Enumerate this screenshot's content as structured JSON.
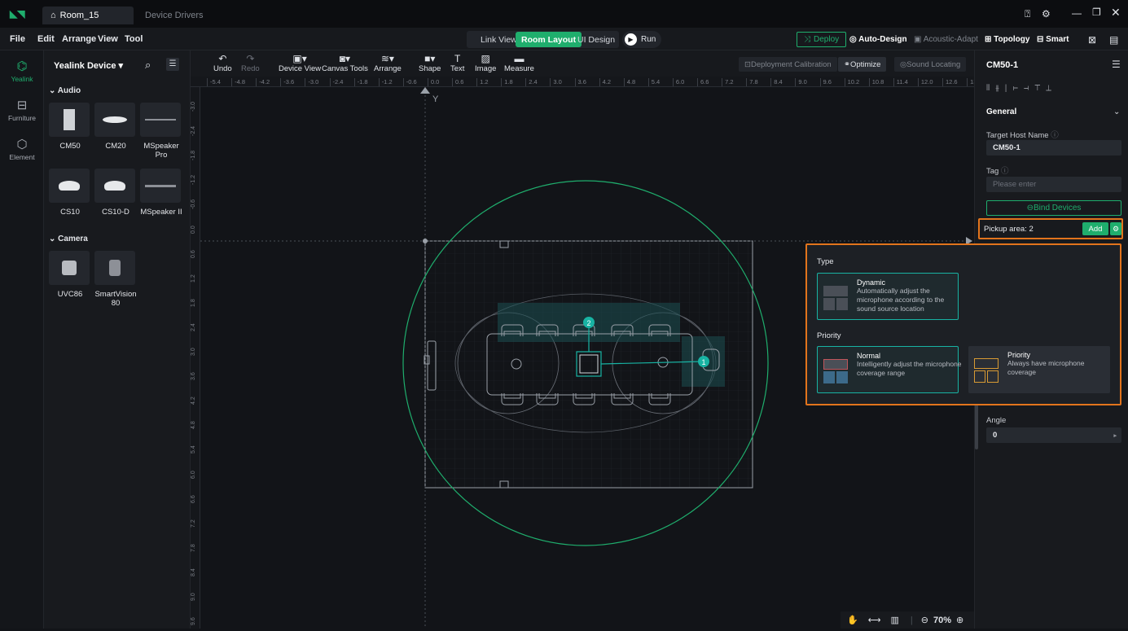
{
  "titlebar": {
    "tabs": [
      {
        "label": "Room_15"
      },
      {
        "label": "Device Drivers"
      }
    ],
    "window_controls": [
      "help-icon",
      "settings-icon",
      "minimize-icon",
      "restore-icon",
      "close-icon"
    ]
  },
  "menubar": {
    "menus": [
      "File",
      "Edit",
      "Arrange",
      "View",
      "Tool"
    ],
    "modes": [
      "Link View",
      "Room Layout",
      "UI Design"
    ],
    "active_mode": "Room Layout",
    "run_label": "Run",
    "right": {
      "deploy": "Deploy",
      "auto_design": "Auto-Design",
      "acoustic_adapt": "Acoustic-Adapt",
      "topology": "Topology",
      "smart": "Smart"
    }
  },
  "leftbar": {
    "items": [
      {
        "label": "Yealink",
        "icon": "cube-icon"
      },
      {
        "label": "Furniture",
        "icon": "chair-icon"
      },
      {
        "label": "Element",
        "icon": "element-icon"
      }
    ]
  },
  "device_panel": {
    "title": "Yealink Device",
    "sections": [
      {
        "name": "Audio",
        "devices": [
          {
            "label": "CM50"
          },
          {
            "label": "CM20"
          },
          {
            "label": "MSpeaker Pro"
          },
          {
            "label": "CS10"
          },
          {
            "label": "CS10-D"
          },
          {
            "label": "MSpeaker II"
          }
        ]
      },
      {
        "name": "Camera",
        "devices": [
          {
            "label": "UVC86"
          },
          {
            "label": "SmartVision 80"
          }
        ]
      }
    ]
  },
  "toolbar": {
    "tools": [
      {
        "label": "Undo"
      },
      {
        "label": "Redo"
      },
      {
        "label": "Device View"
      },
      {
        "label": "Canvas Tools"
      },
      {
        "label": "Arrange"
      },
      {
        "label": "Shape"
      },
      {
        "label": "Text"
      },
      {
        "label": "Image"
      },
      {
        "label": "Measure"
      }
    ],
    "right": {
      "calibration": "Deployment Calibration",
      "optimize": "Optimize",
      "locating": "Sound Locating"
    }
  },
  "rulers": {
    "top": [
      "-5.4",
      "-4.8",
      "-4.2",
      "-3.6",
      "-3.0",
      "-2.4",
      "-1.8",
      "-1.2",
      "-0.6",
      "0.0",
      "0.6",
      "1.2",
      "1.8",
      "2.4",
      "3.0",
      "3.6",
      "4.2",
      "4.8",
      "5.4",
      "6.0",
      "6.6",
      "7.2",
      "7.8",
      "8.4",
      "9.0",
      "9.6",
      "10.2",
      "10.8",
      "11.4",
      "12.0",
      "12.6",
      "13"
    ],
    "left": [
      "-3.0",
      "-2.4",
      "-1.8",
      "-1.2",
      "-0.6",
      "0.0",
      "0.6",
      "1.2",
      "1.8",
      "2.4",
      "3.0",
      "3.6",
      "4.2",
      "4.8",
      "5.4",
      "6.0",
      "6.6",
      "7.2",
      "7.8",
      "8.4",
      "9.0",
      "9.6"
    ]
  },
  "canvas": {
    "axis_y_label": "Y",
    "mic_markers": [
      "1",
      "2"
    ]
  },
  "right_panel": {
    "title": "CM50-1",
    "section": "General",
    "target_host_label": "Target Host Name",
    "target_host_value": "CM50-1",
    "tag_label": "Tag",
    "tag_placeholder": "Please enter",
    "bind_devices": "Bind Devices",
    "pickup_area": "Pickup area: 2",
    "add_label": "Add",
    "angle_label": "Angle",
    "angle_value": "0"
  },
  "popup": {
    "type_heading": "Type",
    "priority_heading": "Priority",
    "dynamic": {
      "title": "Dynamic",
      "desc": "Automatically adjust the microphone according to the sound source location"
    },
    "normal": {
      "title": "Normal",
      "desc": "Intelligently adjust the microphone coverage range"
    },
    "priority": {
      "title": "Priority",
      "desc": "Always have microphone coverage"
    }
  },
  "zoom": {
    "value": "70%"
  },
  "colors": {
    "accent": "#1fae6d",
    "teal": "#18b3a3",
    "highlight": "#e2741c"
  }
}
